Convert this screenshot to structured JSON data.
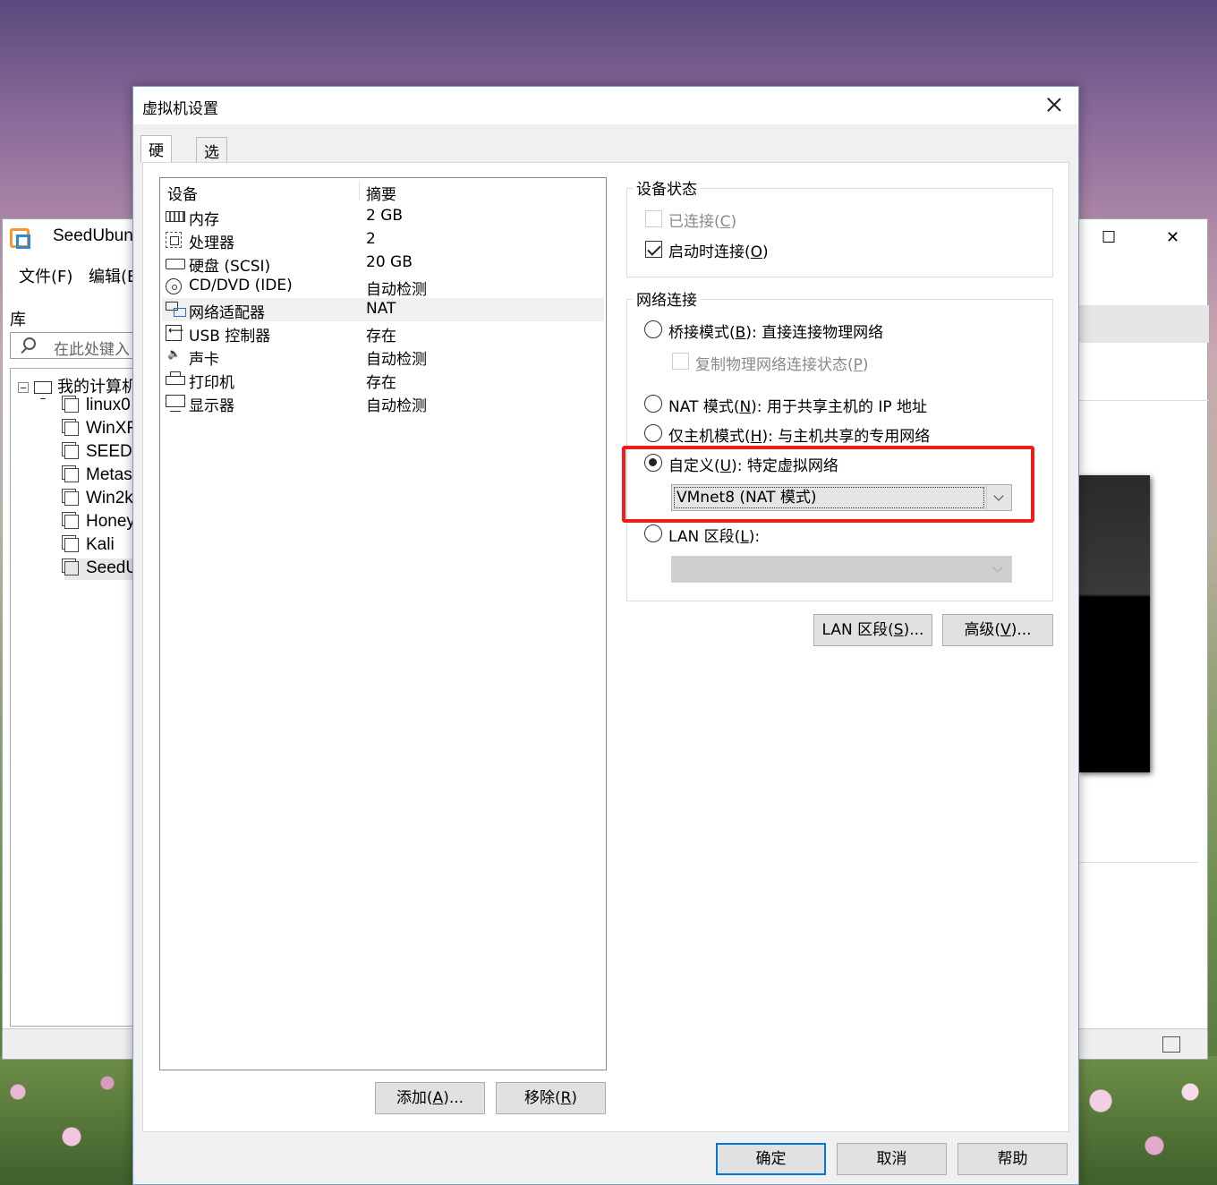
{
  "background_window": {
    "title": "SeedUbun",
    "menu": [
      "文件(F)",
      "编辑(E"
    ],
    "library_label": "库",
    "search_placeholder": "在此处键入",
    "tree_root": "我的计算机",
    "tree_items": [
      "linux0",
      "WinXF",
      "SEEDU",
      "Metas",
      "Win2k",
      "Honey",
      "Kali",
      "SeedU"
    ],
    "maximize_glyph": "☐",
    "close_glyph": "✕"
  },
  "dialog": {
    "title": "虚拟机设置",
    "tabs": [
      "硬件",
      "选项"
    ],
    "active_tab": 0,
    "device_table": {
      "col_device": "设备",
      "col_summary": "摘要",
      "rows": [
        {
          "icon": "memory-icon",
          "name": "内存",
          "value": "2 GB"
        },
        {
          "icon": "processor-icon",
          "name": "处理器",
          "value": "2"
        },
        {
          "icon": "hard-disk-icon",
          "name": "硬盘 (SCSI)",
          "value": "20 GB"
        },
        {
          "icon": "cd-dvd-icon",
          "name": "CD/DVD (IDE)",
          "value": "自动检测"
        },
        {
          "icon": "network-adapter-icon",
          "name": "网络适配器",
          "value": "NAT"
        },
        {
          "icon": "usb-controller-icon",
          "name": "USB 控制器",
          "value": "存在"
        },
        {
          "icon": "sound-card-icon",
          "name": "声卡",
          "value": "自动检测"
        },
        {
          "icon": "printer-icon",
          "name": "打印机",
          "value": "存在"
        },
        {
          "icon": "display-icon",
          "name": "显示器",
          "value": "自动检测"
        }
      ],
      "selected_row": 4
    },
    "add_button": {
      "text": "添加(",
      "key": "A",
      "tail": ")..."
    },
    "remove_button": {
      "text": "移除(",
      "key": "R",
      "tail": ")"
    },
    "device_status": {
      "title": "设备状态",
      "connected": {
        "text": "已连接(",
        "key": "C",
        "tail": ")",
        "checked": false,
        "enabled": false
      },
      "connect_at_power_on": {
        "text": "启动时连接(",
        "key": "O",
        "tail": ")",
        "checked": true,
        "enabled": true
      }
    },
    "network_connection": {
      "title": "网络连接",
      "bridged": {
        "text": "桥接模式(",
        "key": "B",
        "tail": "): 直接连接物理网络"
      },
      "replicate": {
        "text": "复制物理网络连接状态(",
        "key": "P",
        "tail": ")"
      },
      "nat": {
        "text": "NAT 模式(",
        "key": "N",
        "tail": "): 用于共享主机的 IP 地址"
      },
      "host_only": {
        "text": "仅主机模式(",
        "key": "H",
        "tail": "): 与主机共享的专用网络"
      },
      "custom": {
        "text": "自定义(",
        "key": "U",
        "tail": "): 特定虚拟网络"
      },
      "custom_select": "VMnet8 (NAT 模式)",
      "lan_segment": {
        "text": "LAN 区段(",
        "key": "L",
        "tail": "):"
      },
      "lan_select": "",
      "selected": "custom"
    },
    "lan_segments_button": {
      "text": "LAN 区段(",
      "key": "S",
      "tail": ")..."
    },
    "advanced_button": {
      "text": "高级(",
      "key": "V",
      "tail": ")..."
    },
    "ok_button": "确定",
    "cancel_button": "取消",
    "help_button": "帮助",
    "highlight_color": "#f01c1c"
  }
}
